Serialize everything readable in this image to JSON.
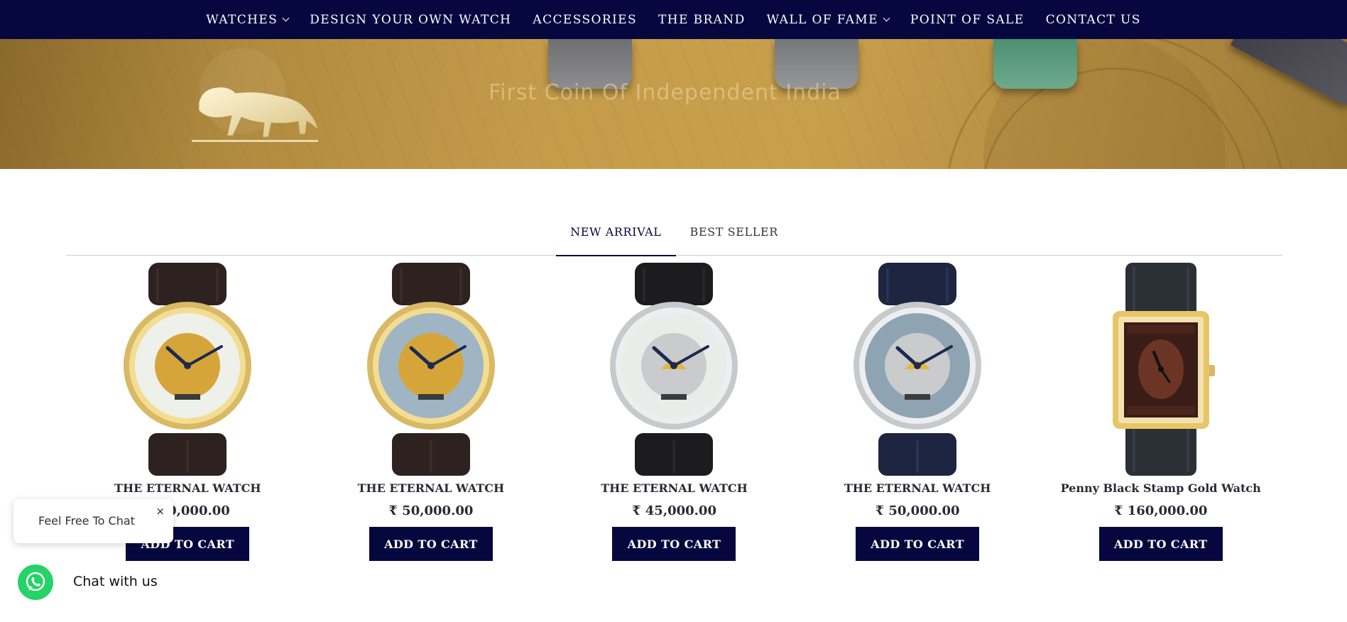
{
  "nav": {
    "items": [
      {
        "label": "WATCHES",
        "has_dropdown": true
      },
      {
        "label": "DESIGN YOUR OWN WATCH",
        "has_dropdown": false
      },
      {
        "label": "ACCESSORIES",
        "has_dropdown": false
      },
      {
        "label": "THE BRAND",
        "has_dropdown": false
      },
      {
        "label": "WALL OF FAME",
        "has_dropdown": true
      },
      {
        "label": "POINT OF SALE",
        "has_dropdown": false
      },
      {
        "label": "CONTACT US",
        "has_dropdown": false
      }
    ],
    "background": "#07073f"
  },
  "hero": {
    "tagline": "First Coin Of Independent India"
  },
  "tabs": [
    {
      "label": "NEW ARRIVAL",
      "active": true
    },
    {
      "label": "BEST SELLER",
      "active": false
    }
  ],
  "products": [
    {
      "name": "THE ETERNAL WATCH",
      "price": "₹ 50,000.00",
      "cta": "ADD TO CART",
      "case": "gold",
      "dial": "mother-of-pearl",
      "strap": "dark-brown"
    },
    {
      "name": "THE ETERNAL WATCH",
      "price": "₹ 50,000.00",
      "cta": "ADD TO CART",
      "case": "gold",
      "dial": "blue-pearl",
      "strap": "dark-brown"
    },
    {
      "name": "THE ETERNAL WATCH",
      "price": "₹ 45,000.00",
      "cta": "ADD TO CART",
      "case": "silver",
      "dial": "mother-of-pearl",
      "strap": "black"
    },
    {
      "name": "THE ETERNAL WATCH",
      "price": "₹ 50,000.00",
      "cta": "ADD TO CART",
      "case": "silver",
      "dial": "blue-pearl",
      "strap": "navy"
    },
    {
      "name": "Penny Black Stamp Gold Watch",
      "price": "₹ 160,000.00",
      "cta": "ADD TO CART",
      "case": "gold-rectangular",
      "dial": "penny-black-stamp",
      "strap": "black"
    }
  ],
  "chat": {
    "bubble_text": "Feel Free To Chat",
    "close_glyph": "×",
    "whatsapp_label": "Chat with us",
    "whatsapp_color": "#25d366"
  },
  "colors": {
    "accent": "#07073f",
    "hero_gold": "#c49b4a"
  }
}
